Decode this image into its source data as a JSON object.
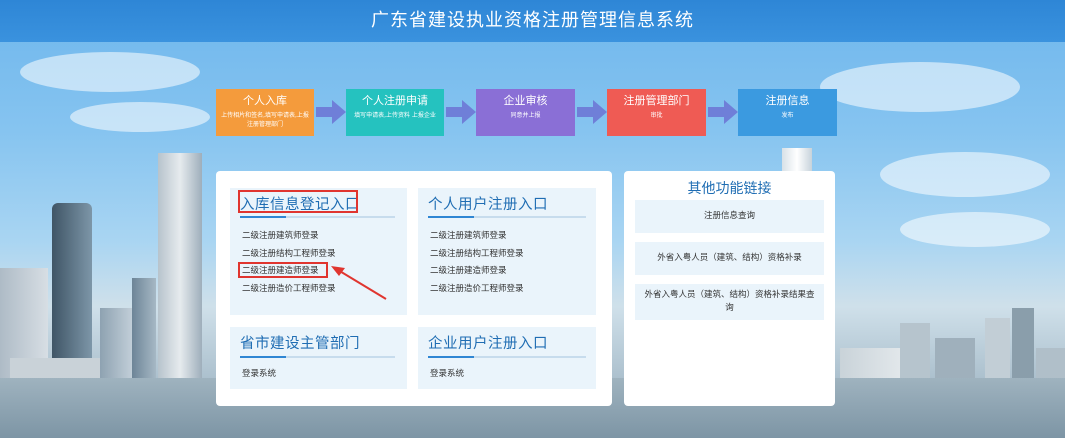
{
  "header": {
    "title": "广东省建设执业资格注册管理信息系统"
  },
  "flow": [
    {
      "title": "个人入库",
      "desc": "上传相片和签名,填写申请表,上报注册管理部门",
      "color": "#f49b3c"
    },
    {
      "title": "个人注册申请",
      "desc": "填写申请表,上传资料 上报企业",
      "color": "#25c2bf"
    },
    {
      "title": "企业审核",
      "desc": "同意并上报",
      "color": "#8a6fd6"
    },
    {
      "title": "注册管理部门",
      "desc": "审批",
      "color": "#ef5b54"
    },
    {
      "title": "注册信息",
      "desc": "发布",
      "color": "#3b9ae0"
    }
  ],
  "cards": {
    "ruku": {
      "title": "入库信息登记入口",
      "links": [
        "二级注册建筑师登录",
        "二级注册结构工程师登录",
        "二级注册建造师登录",
        "二级注册造价工程师登录"
      ]
    },
    "personal": {
      "title": "个人用户注册入口",
      "links": [
        "二级注册建筑师登录",
        "二级注册结构工程师登录",
        "二级注册建造师登录",
        "二级注册造价工程师登录"
      ]
    },
    "city": {
      "title": "省市建设主管部门",
      "links": [
        "登录系统"
      ]
    },
    "enterprise": {
      "title": "企业用户注册入口",
      "links": [
        "登录系统"
      ]
    }
  },
  "side": {
    "title": "其他功能链接",
    "links": [
      "注册信息查询",
      "外省入粤人员（建筑、结构）资格补录",
      "外省入粤人员（建筑、结构）资格补录结果查询"
    ]
  },
  "colors": {
    "header": "#3a92de",
    "accent": "#1f6db3",
    "highlight": "#e0352f",
    "arrow": "#6f7fd8"
  }
}
